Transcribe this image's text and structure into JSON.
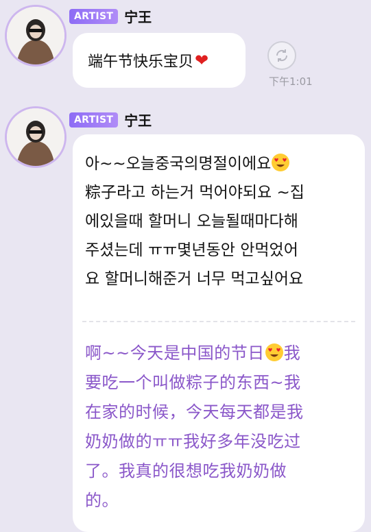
{
  "messages": [
    {
      "badge": "ARTIST",
      "sender": "宁王",
      "text": "端午节快乐宝贝",
      "time": "下午1:01"
    },
    {
      "badge": "ARTIST",
      "sender": "宁王",
      "korean_lines": [
        "아~~오늘중국의명절이에요",
        "粽子라고 하는거 먹어야되요 ~집",
        "에있을때 할머니 오늘될때마다해",
        "주셨는데 ㅠㅠ몇년동안 안먹었어",
        "요 할머니해준거 너무 먹고싶어요"
      ],
      "chinese_lines": [
        "啊~~今天是中国的节日",
        "我",
        "要吃一个叫做粽子的东西~我",
        "在家的时候，今天每天都是我",
        "奶奶做的ㅠㅠ我好多年没吃过",
        "了。我真的很想吃我奶奶做",
        "的。"
      ]
    }
  ],
  "icons": {
    "heart": "red-heart-emoji",
    "heart_eyes": "heart-eyes-emoji",
    "translate": "translate-icon"
  }
}
